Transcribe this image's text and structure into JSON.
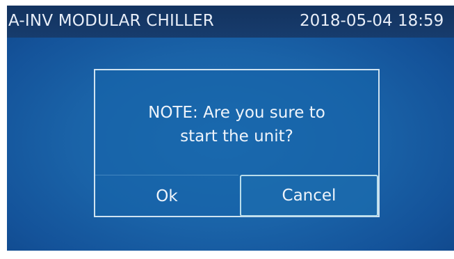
{
  "header": {
    "title": "A-INV MODULAR CHILLER",
    "datetime": "2018-05-04 18:59"
  },
  "dialog": {
    "message_line1": "NOTE: Are you sure to",
    "message_line2": "start the unit?",
    "ok_label": "Ok",
    "cancel_label": "Cancel"
  }
}
